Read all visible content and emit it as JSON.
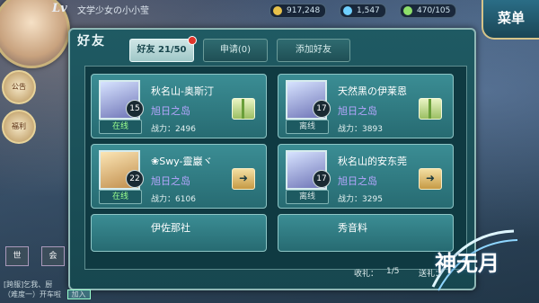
{
  "hud": {
    "level_prefix": "Lv",
    "player_name": "文学少女の小小莹",
    "gold": "917,248",
    "gems": "1,547",
    "stamina": "470/105",
    "menu_label": "菜单"
  },
  "side": {
    "notice_label": "公告",
    "welfare_label": "福利"
  },
  "panel": {
    "title": "好友",
    "tabs": [
      "好友 21/50",
      "申请(0)",
      "添加好友"
    ],
    "server_label": "旭日之岛",
    "power_label": "战力："
  },
  "friends": [
    {
      "name": "秋名山-奥斯汀",
      "level": "15",
      "status": "在线",
      "power": "2496",
      "action": "gift"
    },
    {
      "name": "天然黑の伊莱恩",
      "level": "17",
      "status": "离线",
      "power": "3893",
      "action": "gift"
    },
    {
      "name": "❀Swy-靈巖ヾ",
      "level": "22",
      "status": "在线",
      "power": "6106",
      "action": "letter"
    },
    {
      "name": "秋名山的安东莞",
      "level": "17",
      "status": "离线",
      "power": "3295",
      "action": "letter"
    },
    {
      "name": "伊佐那社",
      "level": "",
      "status": "",
      "power": "",
      "action": ""
    },
    {
      "name": "秀音料",
      "level": "",
      "status": "",
      "power": "",
      "action": ""
    }
  ],
  "bottom": {
    "received_label": "收礼：",
    "received_value": "1/5",
    "sent_label": "送礼："
  },
  "chat": {
    "line1_tag": "[跨服]",
    "line1_text": "乞我、厨",
    "line2_text": "（难度一）开车啦",
    "join_label": "加入",
    "world_label": "世",
    "society_label": "会"
  },
  "logo_text": "神无月"
}
